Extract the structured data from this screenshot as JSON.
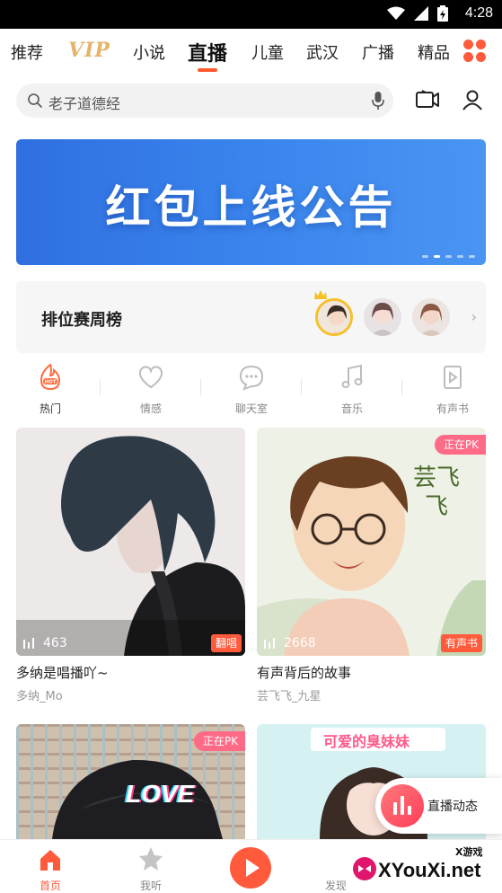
{
  "status_bar": {
    "time": "4:28"
  },
  "top_tabs": {
    "items": [
      "推荐",
      "VIP",
      "小说",
      "直播",
      "儿童",
      "武汉",
      "广播",
      "精品"
    ],
    "active": "直播"
  },
  "search": {
    "placeholder": "老子道德经"
  },
  "banner": {
    "title": "红包上线公告",
    "page_count": 5,
    "active_page": 2
  },
  "ranking": {
    "label": "排位赛周榜"
  },
  "categories": [
    {
      "label": "热门",
      "icon": "hot-icon",
      "active": true
    },
    {
      "label": "情感",
      "icon": "heart-icon"
    },
    {
      "label": "聊天室",
      "icon": "chat-icon"
    },
    {
      "label": "音乐",
      "icon": "music-note-icon"
    },
    {
      "label": "有声书",
      "icon": "audiobook-icon"
    }
  ],
  "cards": [
    {
      "title": "多纳是唱播吖~",
      "host": "多纳_Mo",
      "listeners": "463",
      "tag": "翻唱"
    },
    {
      "title": "有声背后的故事",
      "host": "芸飞飞_九星",
      "listeners": "2668",
      "tag": "有声书",
      "badge": "正在PK",
      "art_text": "芸飞飞"
    },
    {
      "badge": "正在PK",
      "art_text": "LOVE"
    },
    {
      "art_text": "可爱的臭妹妹"
    }
  ],
  "floating": {
    "label": "直播动态"
  },
  "bottom_nav": {
    "items": [
      {
        "label": "首页",
        "icon": "home-icon",
        "active": true
      },
      {
        "label": "我听",
        "icon": "star-icon"
      },
      {
        "label": "",
        "icon": "play-icon"
      },
      {
        "label": "发现",
        "icon": "discover-icon"
      }
    ]
  },
  "watermark": {
    "small": "X游戏",
    "text": "XYouXi.net"
  },
  "colors": {
    "accent": "#ff5a3c",
    "banner": "#3b86ee",
    "pk_badge": "#ff6a86",
    "vip_gold": "#e5b46a"
  }
}
